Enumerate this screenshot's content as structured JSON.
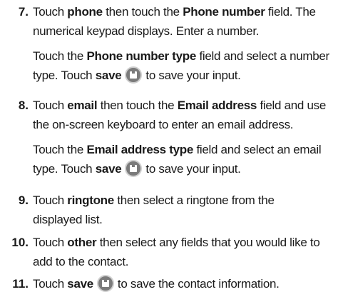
{
  "steps": [
    {
      "number": "7.",
      "lines": [
        {
          "t1": "Touch ",
          "b1": "phone",
          "t2": " then touch the ",
          "b2": "Phone number",
          "t3": " field. The"
        },
        {
          "t1": "numerical keypad displays. Enter a number."
        },
        {
          "t1": "Touch the ",
          "b1": "Phone number type",
          "t2": " field and select a number"
        },
        {
          "t1": "type. Touch ",
          "b1": "save",
          "t2": "to save your input."
        }
      ]
    },
    {
      "number": "8.",
      "lines": [
        {
          "t1": "Touch ",
          "b1": "email",
          "t2": " then touch the ",
          "b2": "Email address",
          "t3": " field and use"
        },
        {
          "t1": "the on-screen keyboard to enter an email address."
        },
        {
          "t1": "Touch the ",
          "b1": "Email address type",
          "t2": " field and select an email"
        },
        {
          "t1": "type. Touch ",
          "b1": "save",
          "t2": "to save your input."
        }
      ]
    },
    {
      "number": "9.",
      "lines": [
        {
          "t1": "Touch ",
          "b1": "ringtone",
          "t2": " then select a ringtone from the"
        },
        {
          "t1": "displayed list."
        }
      ]
    },
    {
      "number": "10.",
      "lines": [
        {
          "t1": "Touch ",
          "b1": "other",
          "t2": " then select any fields that you would like to"
        },
        {
          "t1": "add to the contact."
        }
      ]
    },
    {
      "number": "11.",
      "lines": [
        {
          "t1": "Touch ",
          "b1": "save",
          "t2": "to save the contact information."
        }
      ]
    }
  ],
  "icons": {
    "save": "save-icon"
  }
}
